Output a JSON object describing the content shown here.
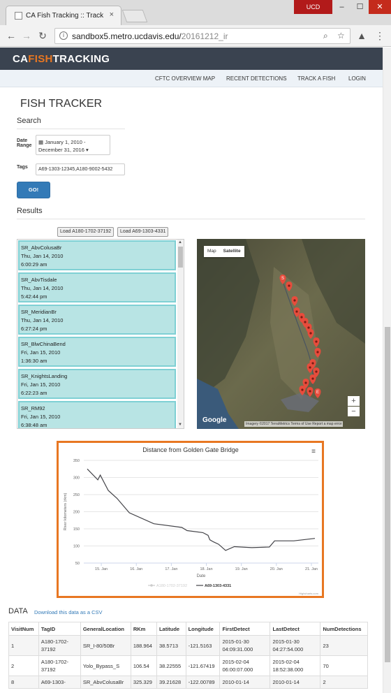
{
  "browser": {
    "tab_title": "CA Fish Tracking :: Track",
    "tab_close": "×",
    "profile": "UCD",
    "url_host": "sandbox5.metro.ucdavis.edu/",
    "url_path": "20161212_ir"
  },
  "site": {
    "logo_ca": "CA",
    "logo_fish": "FISH",
    "logo_tracking": "TRACKING",
    "nav": [
      "CFTC OVERVIEW MAP",
      "RECENT DETECTIONS",
      "TRACK A FISH",
      "LOGIN"
    ]
  },
  "page_title": "FISH TRACKER",
  "search": {
    "heading": "Search",
    "date_label_1": "Date",
    "date_label_2": "Range",
    "date_line1": "January 1, 2010 -",
    "date_line2": "December 31, 2016",
    "tags_label": "Tags",
    "tags_value": "A69-1303-12345,A180-9002-5432",
    "go_label": "GO!"
  },
  "results": {
    "heading": "Results",
    "load_a": "Load A180-1702-37192",
    "load_b": "Load A69-1303-4331",
    "items": [
      {
        "name": "SR_AbvColusaBr",
        "date": "Thu, Jan 14, 2010",
        "time": "6:00:29 am"
      },
      {
        "name": "SR_AbvTisdale",
        "date": "Thu, Jan 14, 2010",
        "time": "5:42:44 pm"
      },
      {
        "name": "SR_MeridianBr",
        "date": "Thu, Jan 14, 2010",
        "time": "6:27:24 pm"
      },
      {
        "name": "SR_BlwChinaBend",
        "date": "Fri, Jan 15, 2010",
        "time": "1:36:30 am"
      },
      {
        "name": "SR_KnightsLanding",
        "date": "Fri, Jan 15, 2010",
        "time": "6:22:23 am"
      },
      {
        "name": "SR_RM92",
        "date": "Fri, Jan 15, 2010",
        "time": "6:38:48 am"
      }
    ]
  },
  "map": {
    "tab_map": "Map",
    "tab_satellite": "Satellite",
    "zoom_in": "+",
    "zoom_out": "−",
    "google": "Google",
    "attribution": "Imagery ©2017 TerraMetrics   Terms of Use   Report a map error",
    "start_marker": "S",
    "end_marker": "E"
  },
  "chart_data": {
    "type": "line",
    "title": "Distance from Golden Gate Bridge",
    "xlabel": "Date",
    "ylabel": "River kilometers (rkm)",
    "x_ticks": [
      "15. Jan",
      "16. Jan",
      "17. Jan",
      "18. Jan",
      "19. Jan",
      "20. Jan",
      "21. Jan"
    ],
    "y_ticks": [
      50,
      100,
      150,
      200,
      250,
      300,
      350
    ],
    "ylim": [
      50,
      350
    ],
    "xlim": [
      14.5,
      21.2
    ],
    "series": [
      {
        "name": "A180-1702-37192",
        "values": []
      },
      {
        "name": "A69-1303-4331",
        "x": [
          14.6,
          14.9,
          14.97,
          15.2,
          15.45,
          15.8,
          16.5,
          17.3,
          17.45,
          17.9,
          18.05,
          18.1,
          18.2,
          18.35,
          18.55,
          18.8,
          19.3,
          19.8,
          19.95,
          20.5,
          21.1
        ],
        "values": [
          325,
          293,
          307,
          262,
          239,
          197,
          165,
          154,
          145,
          139,
          131,
          118,
          112,
          105,
          87,
          98,
          95,
          97,
          115,
          115,
          122
        ]
      }
    ],
    "legend": "bottom",
    "credits": "Highcharts.com",
    "menu_icon": "≡"
  },
  "data_section": {
    "heading": "DATA",
    "csv_link": "Download this data as a CSV",
    "columns": [
      "VisitNum",
      "TagID",
      "GeneralLocation",
      "RKm",
      "Latitude",
      "Longitude",
      "FirstDetect",
      "LastDetect",
      "NumDetections"
    ],
    "rows": [
      [
        "1",
        "A180-1702-37192",
        "SR_I-80/50Br",
        "188.964",
        "38.5713",
        "-121.5163",
        "2015-01-30 04:09:31.000",
        "2015-01-30 04:27:54.000",
        "23"
      ],
      [
        "2",
        "A180-1702-37192",
        "Yolo_Bypass_S",
        "106.54",
        "38.22555",
        "-121.67419",
        "2015-02-04 06:00:07.000",
        "2015-02-04 18:52:38.000",
        "70"
      ],
      [
        "8",
        "A69-1303-",
        "SR_AbvColusaBr",
        "325.329",
        "39.21628",
        "-122.00789",
        "2010-01-14",
        "2010-01-14",
        "2"
      ]
    ]
  }
}
